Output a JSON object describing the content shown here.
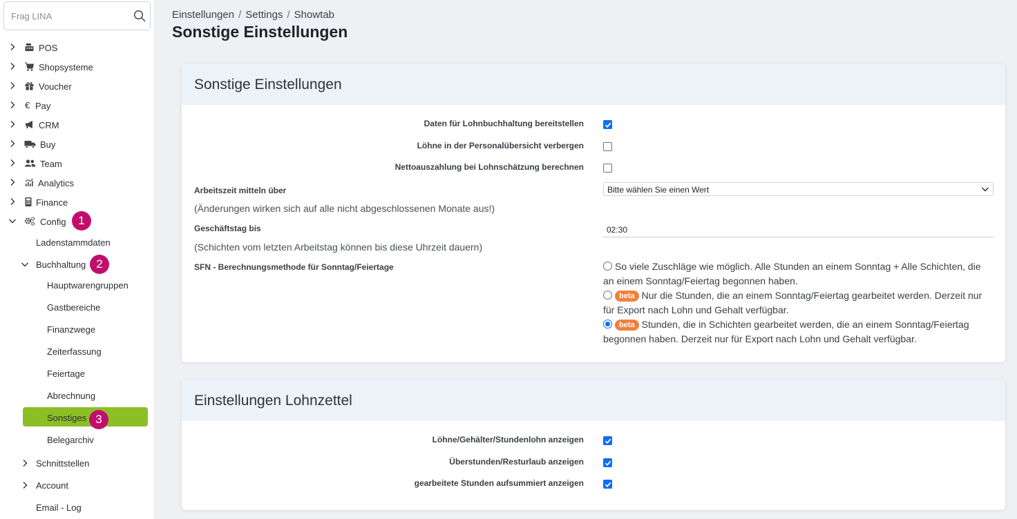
{
  "search": {
    "placeholder": "Frag LINA"
  },
  "sidebar": {
    "items": [
      {
        "label": "POS",
        "icon": "cash-register-icon"
      },
      {
        "label": "Shopsysteme",
        "icon": "cart-icon"
      },
      {
        "label": "Voucher",
        "icon": "gift-icon"
      },
      {
        "label": "Pay",
        "icon": "euro-icon"
      },
      {
        "label": "CRM",
        "icon": "megaphone-icon"
      },
      {
        "label": "Buy",
        "icon": "truck-icon"
      },
      {
        "label": "Team",
        "icon": "users-icon"
      },
      {
        "label": "Analytics",
        "icon": "chart-icon"
      },
      {
        "label": "Finance",
        "icon": "calculator-icon"
      },
      {
        "label": "Config",
        "icon": "gears-icon"
      }
    ],
    "config_children": {
      "ladenstammdaten": "Ladenstammdaten",
      "buchhaltung": "Buchhaltung",
      "buchhaltung_children": [
        "Hauptwarengruppen",
        "Gastbereiche",
        "Finanzwege",
        "Zeiterfassung",
        "Feiertage",
        "Abrechnung",
        "Sonstiges",
        "Belegarchiv"
      ],
      "schnittstellen": "Schnittstellen",
      "account": "Account",
      "email_log": "Email - Log"
    },
    "annotations": [
      "1",
      "2",
      "3"
    ],
    "active_color": "#8cbf26",
    "annotation_color": "#c20e6b"
  },
  "breadcrumb": [
    "Einstellungen",
    "Settings",
    "Showtab"
  ],
  "page_title": "Sonstige Einstellungen",
  "card1": {
    "title": "Sonstige Einstellungen",
    "checkbox_rows": [
      {
        "label": "Daten für Lohnbuchhaltung bereitstellen",
        "checked": true
      },
      {
        "label": "Löhne in der Personalübersicht verbergen",
        "checked": false
      },
      {
        "label": "Nettoauszahlung bei Lohnschätzung berechnen",
        "checked": false
      }
    ],
    "arbeitszeit": {
      "label": "Arbeitszeit mitteln über",
      "hint": "(Änderungen wirken sich auf alle nicht abgeschlossenen Monate aus!)",
      "select_value": "Bitte wählen Sie einen Wert"
    },
    "geschaeftstag": {
      "label": "Geschäftstag bis",
      "hint": "(Schichten vom letzten Arbeitstag können bis diese Uhrzeit dauern)",
      "value": "02:30"
    },
    "sfn": {
      "label": "SFN - Berechnungsmethode für Sonntag/Feiertage",
      "beta_label": "beta",
      "options": [
        {
          "text": "So viele Zuschläge wie möglich. Alle Stunden an einem Sonntag + Alle Schichten, die an einem Sonntag/Feiertag begonnen haben.",
          "beta": false,
          "selected": false
        },
        {
          "text": "Nur die Stunden, die an einem Sonntag/Feiertag gearbeitet werden. Derzeit nur für Export nach Lohn und Gehalt verfügbar.",
          "beta": true,
          "selected": false
        },
        {
          "text": "Stunden, die in Schichten gearbeitet werden, die an einem Sonntag/Feiertag begonnen haben. Derzeit nur für Export nach Lohn und Gehalt verfügbar.",
          "beta": true,
          "selected": true
        }
      ]
    }
  },
  "card2": {
    "title": "Einstellungen Lohnzettel",
    "checkbox_rows": [
      {
        "label": "Löhne/Gehälter/Stundenlohn anzeigen",
        "checked": true
      },
      {
        "label": "Überstunden/Resturlaub anzeigen",
        "checked": true
      },
      {
        "label": "gearbeitete Stunden aufsummiert anzeigen",
        "checked": true
      }
    ]
  }
}
